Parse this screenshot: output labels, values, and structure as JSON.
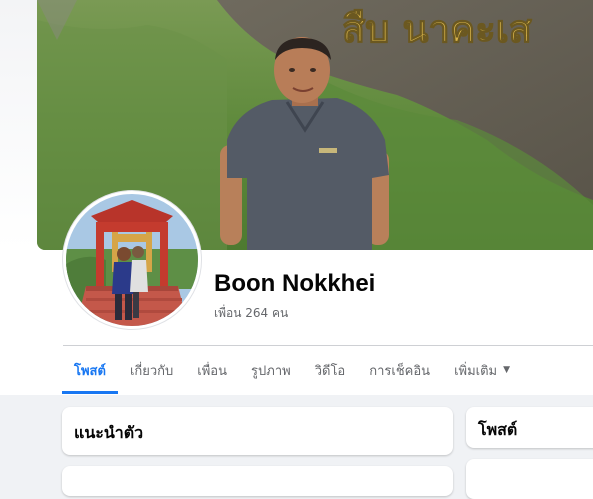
{
  "profile": {
    "name": "Boon Nokkhei",
    "friends_count_label": "เพื่อน 264 คน",
    "cover_sign_text": "สืบ นาคะเส"
  },
  "tabs": [
    {
      "label": "โพสต์",
      "active": true
    },
    {
      "label": "เกี่ยวกับ",
      "active": false
    },
    {
      "label": "เพื่อน",
      "active": false
    },
    {
      "label": "รูปภาพ",
      "active": false
    },
    {
      "label": "วิดีโอ",
      "active": false
    },
    {
      "label": "การเช็คอิน",
      "active": false
    },
    {
      "label": "เพิ่มเติม",
      "active": false,
      "has_dropdown": true,
      "icon": "caret-down-icon"
    }
  ],
  "intro_card": {
    "title": "แนะนำตัว"
  },
  "posts_card": {
    "title": "โพสต์"
  },
  "colors": {
    "accent": "#1877f2",
    "background": "#f0f2f5",
    "secondary_text": "#65676b"
  }
}
